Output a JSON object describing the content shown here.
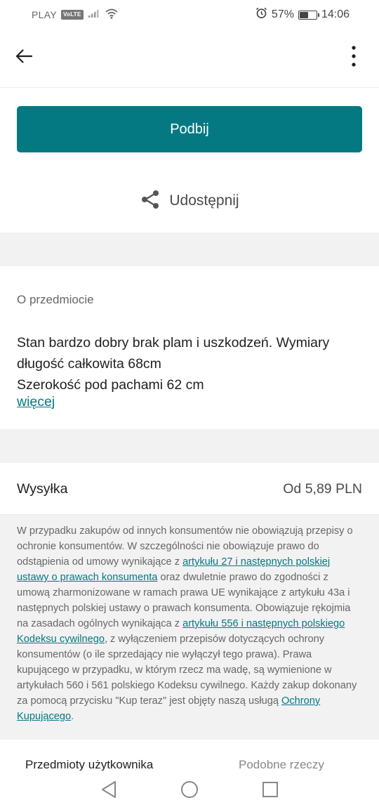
{
  "status_bar": {
    "carrier": "PLAY",
    "volte": "VoLTE",
    "battery_percent": "57%",
    "battery_level": 0.57,
    "time": "14:06",
    "icons": [
      "signal-icon",
      "wifi-icon",
      "alarm-icon",
      "battery-icon"
    ]
  },
  "toolbar": {
    "back_icon": "arrow-left-icon",
    "more_icon": "more-vertical-icon"
  },
  "actions": {
    "bump_label": "Podbij",
    "share_label": "Udostępnij",
    "share_icon": "share-icon"
  },
  "about": {
    "label": "O przedmiocie",
    "description_lines": [
      "Stan bardzo dobry brak plam i uszkodzeń. Wymiary",
      "długość całkowita 68cm",
      "Szerokość pod pachami 62 cm"
    ],
    "more_label": "więcej"
  },
  "shipping": {
    "title": "Wysyłka",
    "price": "Od 5,89 PLN"
  },
  "legal": {
    "t1": "W przypadku zakupów od innych konsumentów nie obowiązują przepisy o ochronie konsumentów. W szczególności nie obowiązuje prawo do odstąpienia od umowy wynikające z ",
    "link1": "artykułu 27 i następnych polskiej ustawy o prawach konsumenta",
    "t2": " oraz dwuletnie prawo do zgodności z umową zharmonizowane w ramach prawa UE wynikające z artykułu 43a i następnych polskiej ustawy o prawach konsumenta. Obowiązuje rękojmia na zasadach ogólnych wynikająca z ",
    "link2": "artykułu 556 i następnych polskiego Kodeksu cywilnego",
    "t3": ", z wyłączeniem przepisów dotyczących ochrony konsumentów (o ile sprzedający nie wyłączył tego prawa). Prawa kupującego w przypadku, w którym rzecz ma wadę, są wymienione w artykułach 560 i 561 polskiego Kodeksu cywilnego. Każdy zakup dokonany za pomocą przycisku \"Kup teraz\" jest objęty naszą usługą ",
    "link3": "Ochrony Kupującego",
    "t4": "."
  },
  "tabs": {
    "user_items": "Przedmioty użytkownika",
    "similar_items": "Podobne rzeczy"
  },
  "nav": {
    "back_icon": "nav-back-icon",
    "home_icon": "nav-home-icon",
    "recents_icon": "nav-recents-icon"
  },
  "colors": {
    "accent": "#047982",
    "separator": "#f2f2f2",
    "text_primary": "#1f1f1f",
    "text_secondary": "#666666"
  }
}
